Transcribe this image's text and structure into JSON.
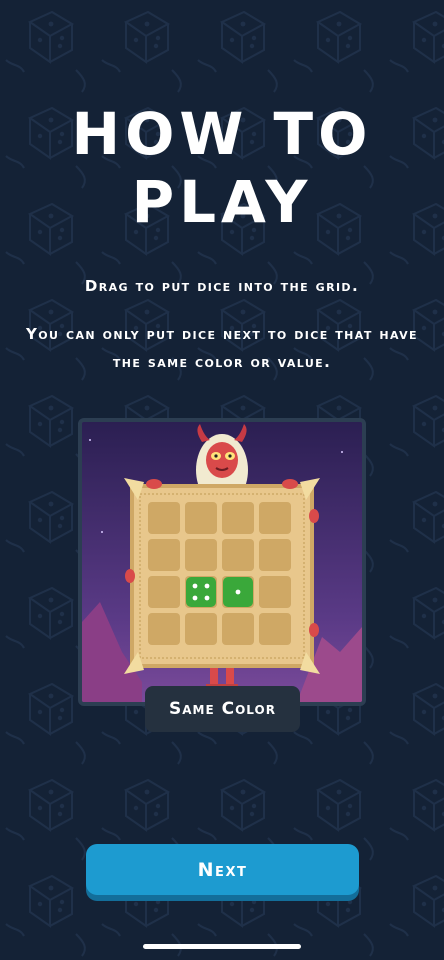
{
  "screen": {
    "title": "HOW TO PLAY",
    "instructions": [
      "Drag to put dice into the grid.",
      "You can only put dice next to dice that have the same color or value."
    ]
  },
  "preview": {
    "caption": "Same Color",
    "grid_rows": 4,
    "grid_cols": 4,
    "dice": [
      {
        "row": 3,
        "col": 2,
        "value": 4,
        "color": "#3aa83a"
      },
      {
        "row": 3,
        "col": 3,
        "value": 1,
        "color": "#3aa83a"
      }
    ],
    "character": "red-horned-creature",
    "colors": {
      "sky": "#3a2864",
      "board": "#e8c78c",
      "cell": "#cfa865"
    }
  },
  "buttons": {
    "next_label": "Next"
  },
  "colors": {
    "background": "#142236",
    "accent": "#1d9bd0",
    "badge": "#25313f"
  }
}
